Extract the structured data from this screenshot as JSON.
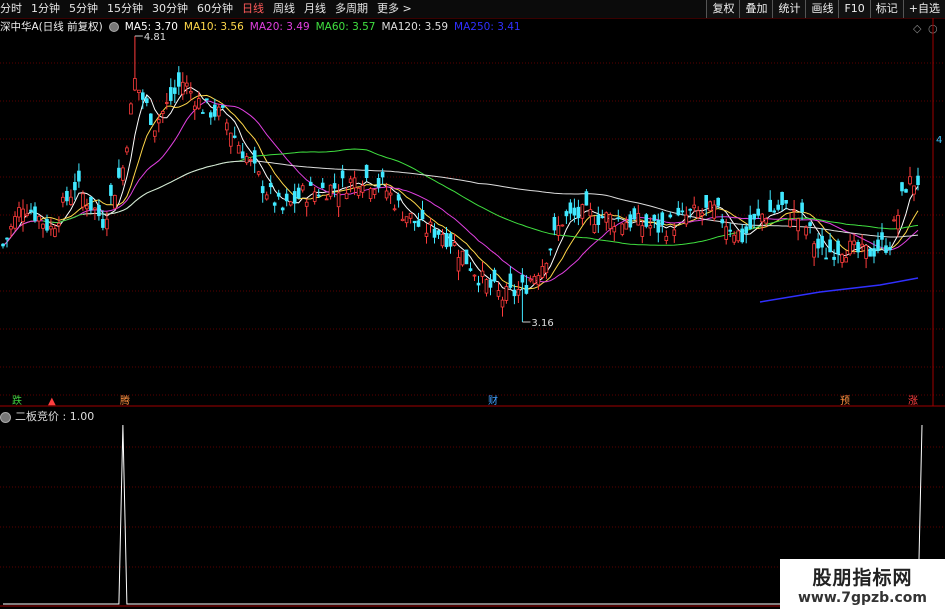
{
  "toolbar": {
    "periods": [
      "分时",
      "1分钟",
      "5分钟",
      "15分钟",
      "30分钟",
      "60分钟",
      "日线",
      "周线",
      "月线",
      "多周期",
      "更多 >"
    ],
    "active_period": "日线",
    "right_buttons": [
      "复权",
      "叠加",
      "统计",
      "画线",
      "F10",
      "标记",
      "+自选"
    ]
  },
  "legend": {
    "title": "深中华A(日线 前复权)",
    "ma": [
      {
        "label": "MA5: 3.70",
        "color": "#ffffff"
      },
      {
        "label": "MA10: 3.56",
        "color": "#ffd84a"
      },
      {
        "label": "MA20: 3.49",
        "color": "#e040e0"
      },
      {
        "label": "MA60: 3.57",
        "color": "#40e040"
      },
      {
        "label": "MA120: 3.59",
        "color": "#dddddd"
      },
      {
        "label": "MA250: 3.41",
        "color": "#3030ff"
      }
    ]
  },
  "annotations": {
    "high": "4.81",
    "low": "3.16",
    "right_axis": "4"
  },
  "event_tags": [
    {
      "text": "跌",
      "color": "#40d040"
    },
    {
      "text": "▲",
      "color": "#ff4040"
    },
    {
      "text": "腾",
      "color": "#ff9040"
    },
    {
      "text": "财",
      "color": "#40a0ff"
    },
    {
      "text": "预",
      "color": "#ff9040"
    },
    {
      "text": "涨",
      "color": "#ff4040"
    }
  ],
  "lower_panel": {
    "title": "二板竞价 : 1.00"
  },
  "watermark": {
    "line1": "股朋指标网",
    "line2": "www.7gpzb.com"
  },
  "colors": {
    "up": "#ff3c3c",
    "down": "#40e8ff",
    "grid": "#5a0000"
  },
  "chart_data": {
    "type": "candlestick",
    "price_range": [
      3.16,
      4.81
    ],
    "signal_values": [
      0,
      0,
      0,
      0,
      0,
      0,
      0,
      0,
      0,
      0,
      0,
      0,
      0,
      0,
      0,
      0,
      0,
      0,
      0,
      0,
      0,
      0,
      0,
      0,
      0,
      0,
      0,
      0,
      0,
      0,
      1,
      0,
      0,
      0,
      0,
      0,
      0,
      0,
      0,
      0,
      0,
      0,
      0,
      0,
      0,
      0,
      0,
      0,
      0,
      0,
      0,
      0,
      0,
      0,
      0,
      0,
      0,
      0,
      0,
      0,
      0,
      0,
      0,
      0,
      0,
      0,
      0,
      0,
      0,
      0,
      0,
      0,
      0,
      0,
      0,
      0,
      0,
      0,
      0,
      0,
      0,
      0,
      0,
      0,
      0,
      0,
      0,
      0,
      0,
      0,
      0,
      0,
      0,
      0,
      0,
      0,
      0,
      0,
      0,
      0,
      0,
      0,
      0,
      0,
      0,
      0,
      0,
      0,
      0,
      0,
      0,
      0,
      0,
      0,
      0,
      0,
      0,
      0,
      0,
      0,
      0,
      0,
      0,
      0,
      0,
      0,
      0,
      0,
      0,
      0,
      0,
      0,
      0,
      0,
      0,
      0,
      0,
      0,
      0,
      0,
      0,
      0,
      0,
      0,
      0,
      0,
      0,
      0,
      0,
      0,
      0,
      0,
      0,
      0,
      0,
      0,
      0,
      0,
      0,
      0,
      0,
      0,
      0,
      0,
      0,
      0,
      0,
      0,
      0,
      0,
      0,
      0,
      0,
      0,
      0,
      0,
      0,
      0,
      0,
      0,
      0,
      0,
      0,
      0,
      0,
      0,
      0,
      0,
      0,
      0,
      0,
      0,
      0,
      0,
      0,
      0,
      0,
      0,
      0,
      0,
      0,
      0,
      0,
      0,
      0,
      0,
      0,
      0,
      0,
      0,
      0,
      0,
      0,
      0,
      0,
      0,
      0,
      0,
      0,
      0,
      0,
      0,
      0,
      0,
      0,
      0,
      0,
      0,
      0,
      0,
      1
    ]
  }
}
